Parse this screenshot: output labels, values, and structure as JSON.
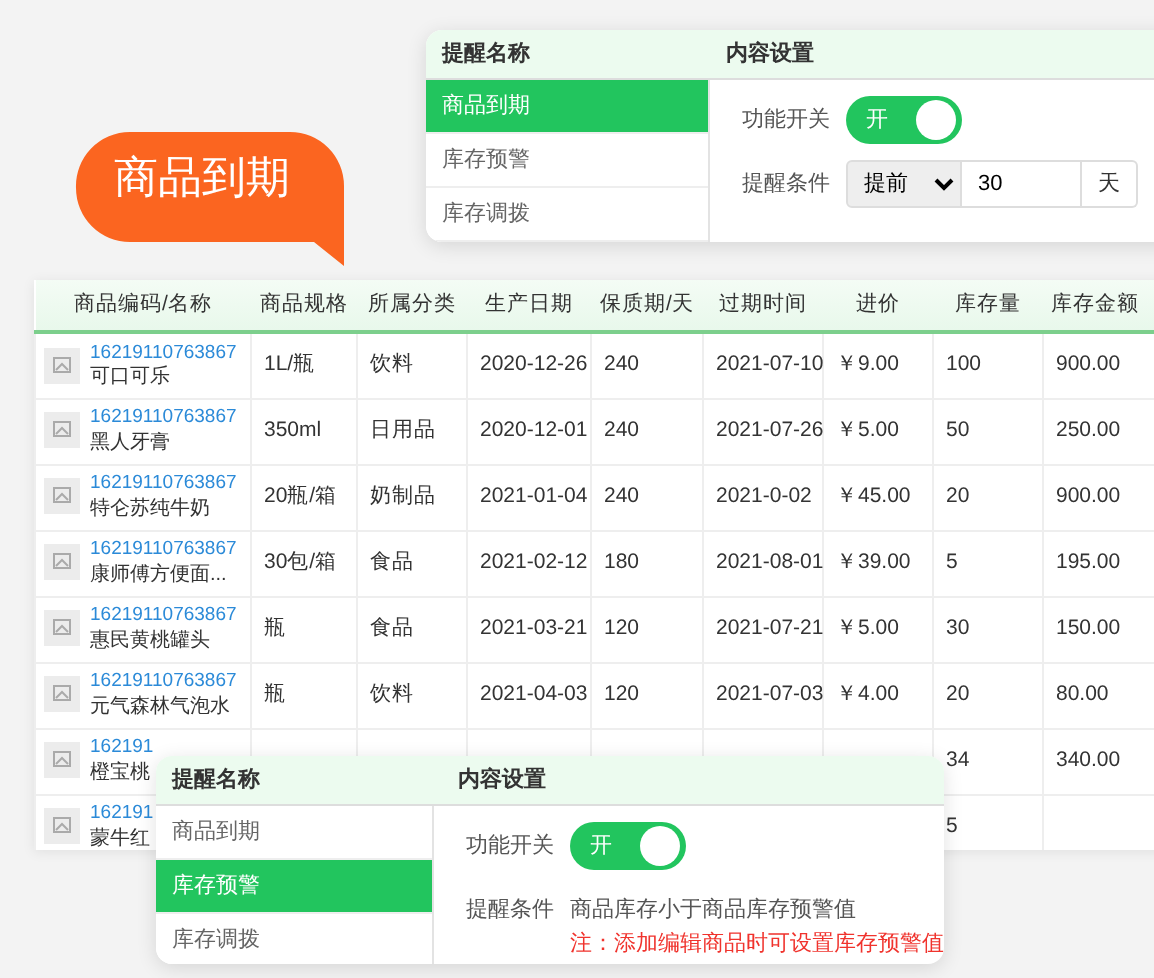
{
  "panels_top": {
    "headers": [
      "提醒名称",
      "内容设置"
    ],
    "items": [
      {
        "label": "商品到期",
        "selected": true
      },
      {
        "label": "库存预警",
        "selected": false
      },
      {
        "label": "库存调拨",
        "selected": false
      }
    ],
    "switch": {
      "label": "功能开关",
      "on": true,
      "text": "开"
    },
    "condition": {
      "kind": "select",
      "label": "提醒条件",
      "option": "提前",
      "value": "30",
      "unit": "天"
    }
  },
  "callout": {
    "text": "商品到期"
  },
  "table": {
    "columns": [
      "商品编码/名称",
      "商品规格",
      "所属分类",
      "生产日期",
      "保质期/天",
      "过期时间",
      "进价",
      "库存量",
      "库存金额"
    ],
    "rows": [
      {
        "code": "16219110763867",
        "name": "可口可乐",
        "spec": "1L/瓶",
        "category": "饮料",
        "production_date": "2020-12-26",
        "shelf_life": "240",
        "expiry_date": "2021-07-10",
        "price": "￥9.00",
        "stock": "100",
        "amount": "900.00"
      },
      {
        "code": "16219110763867",
        "name": "黑人牙膏",
        "spec": "350ml",
        "category": "日用品",
        "production_date": "2020-12-01",
        "shelf_life": "240",
        "expiry_date": "2021-07-26",
        "price": "￥5.00",
        "stock": "50",
        "amount": "250.00"
      },
      {
        "code": "16219110763867",
        "name": "特仑苏纯牛奶",
        "spec": "20瓶/箱",
        "category": "奶制品",
        "production_date": "2021-01-04",
        "shelf_life": "240",
        "expiry_date": "2021-0-02",
        "price": "￥45.00",
        "stock": "20",
        "amount": "900.00"
      },
      {
        "code": "16219110763867",
        "name": "康师傅方便面...",
        "spec": "30包/箱",
        "category": "食品",
        "production_date": "2021-02-12",
        "shelf_life": "180",
        "expiry_date": "2021-08-01",
        "price": "￥39.00",
        "stock": "5",
        "amount": "195.00"
      },
      {
        "code": "16219110763867",
        "name": "惠民黄桃罐头",
        "spec": "瓶",
        "category": "食品",
        "production_date": "2021-03-21",
        "shelf_life": "120",
        "expiry_date": "2021-07-21",
        "price": "￥5.00",
        "stock": "30",
        "amount": "150.00"
      },
      {
        "code": "16219110763867",
        "name": "元气森林气泡水",
        "spec": "瓶",
        "category": "饮料",
        "production_date": "2021-04-03",
        "shelf_life": "120",
        "expiry_date": "2021-07-03",
        "price": "￥4.00",
        "stock": "20",
        "amount": "80.00"
      },
      {
        "code": "162191",
        "name": "橙宝桃",
        "stock": "34",
        "amount": "340.00"
      },
      {
        "code": "162191",
        "name": "蒙牛红",
        "stock": "5"
      }
    ]
  },
  "panels_bottom": {
    "headers": [
      "提醒名称",
      "内容设置"
    ],
    "items": [
      {
        "label": "商品到期",
        "selected": false
      },
      {
        "label": "库存预警",
        "selected": true
      },
      {
        "label": "库存调拨",
        "selected": false
      }
    ],
    "switch": {
      "label": "功能开关",
      "on": true,
      "text": "开"
    },
    "condition": {
      "kind": "text",
      "label": "提醒条件",
      "text": "商品库存小于商品库存预警值",
      "note": "注：添加编辑商品时可设置库存预警值"
    }
  }
}
